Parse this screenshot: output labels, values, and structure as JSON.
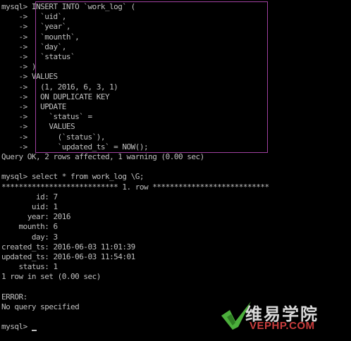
{
  "terminal": {
    "lines": [
      "mysql> INSERT INTO `work_log` (",
      "    ->   `uid`,",
      "    ->   `year`,",
      "    ->   `mounth`,",
      "    ->   `day`,",
      "    ->   `status`",
      "    -> )",
      "    -> VALUES",
      "    ->   (1, 2016, 6, 3, 1)",
      "    ->   ON DUPLICATE KEY",
      "    ->   UPDATE",
      "    ->     `status` =",
      "    ->     VALUES",
      "    ->       (`status`),",
      "    ->       `updated_ts` = NOW();",
      "Query OK, 2 rows affected, 1 warning (0.00 sec)",
      "",
      "mysql> select * from work_log \\G;",
      "*************************** 1. row ***************************",
      "        id: 7",
      "       uid: 1",
      "      year: 2016",
      "    mounth: 6",
      "       day: 3",
      "created_ts: 2016-06-03 11:01:39",
      "updated_ts: 2016-06-03 11:54:01",
      "    status: 1",
      "1 row in set (0.00 sec)",
      "",
      "ERROR:",
      "No query specified",
      "",
      "mysql> "
    ],
    "colors": {
      "background": "#000000",
      "text": "#c0c0c0",
      "selection_border": "#a040a0"
    }
  },
  "watermark": {
    "logo_icon": "green-check-swoosh-icon",
    "chinese_text": "维易学院",
    "site_text": "VEPHP.COM",
    "colors": {
      "swoosh": "#4caf3c",
      "chinese": "#d9d9d9",
      "site": "#c93c3c"
    }
  }
}
